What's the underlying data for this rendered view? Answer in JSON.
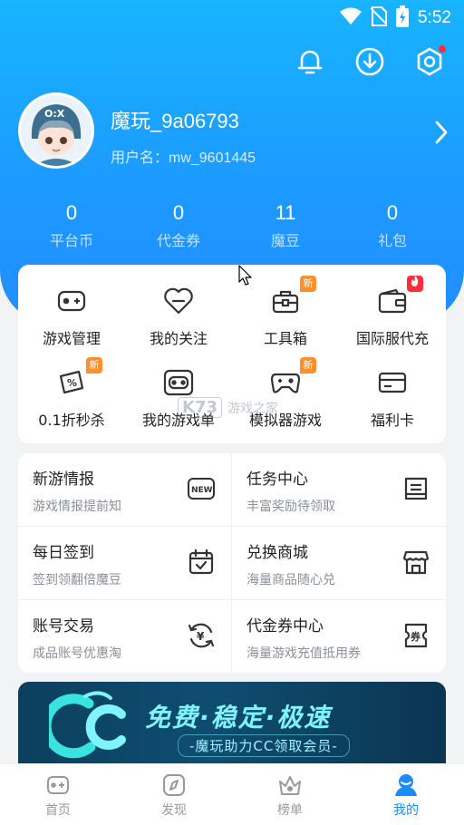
{
  "status_bar": {
    "time": "5:52"
  },
  "profile": {
    "username": "魔玩_9a06793",
    "user_id_label": "用户名：mw_9601445"
  },
  "stats": [
    {
      "value": "0",
      "label": "平台币"
    },
    {
      "value": "0",
      "label": "代金券"
    },
    {
      "value": "11",
      "label": "魔豆"
    },
    {
      "value": "0",
      "label": "礼包"
    }
  ],
  "tools": [
    {
      "label": "游戏管理",
      "icon": "gamepad-icon"
    },
    {
      "label": "我的关注",
      "icon": "heart-icon"
    },
    {
      "label": "工具箱",
      "icon": "toolbox-icon",
      "badge": "新"
    },
    {
      "label": "国际服代充",
      "icon": "wallet-icon",
      "badge": "hot"
    },
    {
      "label": "0.1折秒杀",
      "icon": "discount-icon",
      "badge": "新"
    },
    {
      "label": "我的游戏单",
      "icon": "game-list-icon"
    },
    {
      "label": "模拟器游戏",
      "icon": "emulator-icon",
      "badge": "新"
    },
    {
      "label": "福利卡",
      "icon": "card-icon"
    }
  ],
  "badge_new": "新",
  "services": [
    {
      "title": "新游情报",
      "subtitle": "游戏情报提前知",
      "icon": "new-icon",
      "icon_text": "NEW"
    },
    {
      "title": "任务中心",
      "subtitle": "丰富奖励待领取",
      "icon": "task-icon"
    },
    {
      "title": "每日签到",
      "subtitle": "签到领翻倍魔豆",
      "icon": "calendar-icon"
    },
    {
      "title": "兑换商城",
      "subtitle": "海量商品随心兑",
      "icon": "store-icon"
    },
    {
      "title": "账号交易",
      "subtitle": "成品账号优惠淘",
      "icon": "exchange-icon",
      "icon_text": "¥"
    },
    {
      "title": "代金券中心",
      "subtitle": "海量游戏充值抵用券",
      "icon": "coupon-icon",
      "icon_text": "券"
    }
  ],
  "banner": {
    "title": "免费·稳定·极速",
    "subtitle": "-魔玩助力CC领取会员-"
  },
  "watermark": {
    "logo": "K73",
    "text": "游戏之家"
  },
  "tabs": [
    {
      "label": "首页",
      "icon": "home-gamepad-icon"
    },
    {
      "label": "发现",
      "icon": "compass-icon"
    },
    {
      "label": "榜单",
      "icon": "crown-icon"
    },
    {
      "label": "我的",
      "icon": "user-icon",
      "active": true
    }
  ],
  "colors": {
    "accent": "#1a8cff",
    "hero_top": "#18b4ff",
    "badge_new": "#ff8f2b",
    "badge_hot": "#ff2d3a"
  }
}
